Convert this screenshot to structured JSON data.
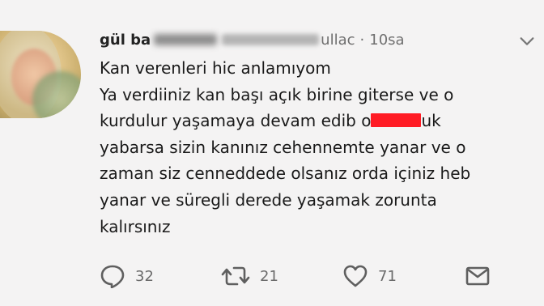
{
  "tweet": {
    "name_visible": "gül ba",
    "handle_tail": "ullac",
    "separator": "·",
    "time": "10sa",
    "lines": [
      "Kan verenleri hic anlamıyom",
      "Ya verdiiniz kan başı açık birine giterse ve o",
      "kurdulur yaşamaya devam edib o",
      "uk",
      "yabarsa sizin kanınız cehennemte yanar ve o",
      "zaman siz cenneddede olsanız orda içiniz heb",
      "yanar ve süregli derede yaşamak zorunta",
      "kalırsınız"
    ],
    "redaction_color": "#ff1b24"
  },
  "actions": {
    "reply_count": "32",
    "retweet_count": "21",
    "like_count": "71"
  },
  "icons": {
    "more": "chevron-down-icon",
    "reply": "reply-icon",
    "retweet": "retweet-icon",
    "like": "heart-icon",
    "message": "envelope-icon"
  }
}
